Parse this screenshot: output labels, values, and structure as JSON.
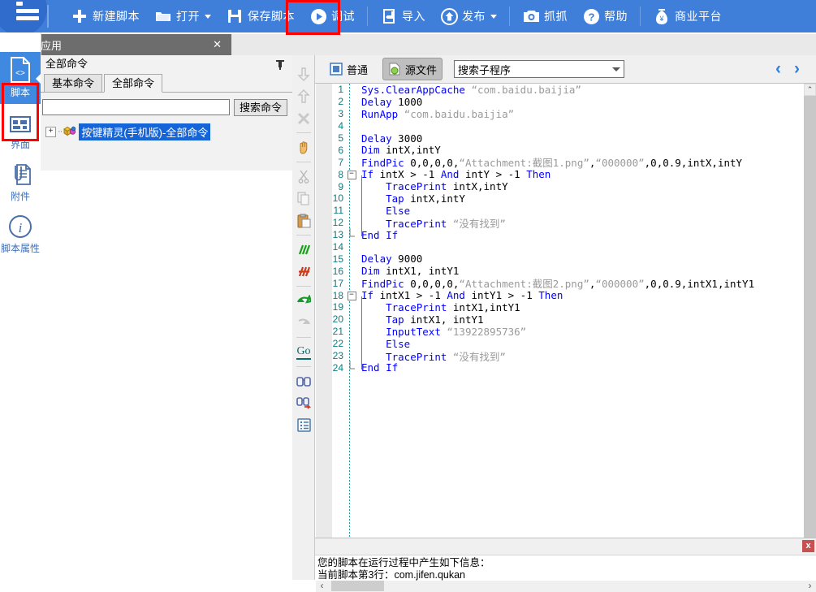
{
  "topbar": {
    "logo_icon": "menu-logo-icon",
    "items": [
      {
        "id": "new-script",
        "label": "新建脚本",
        "icon": "plus-icon",
        "caret": false
      },
      {
        "id": "open",
        "label": "打开",
        "icon": "folder-icon",
        "caret": true
      },
      {
        "id": "save-script",
        "label": "保存脚本",
        "icon": "save-disk-icon",
        "caret": false
      },
      {
        "id": "debug",
        "label": "调试",
        "icon": "play-circle-icon",
        "caret": false,
        "highlighted": true
      },
      {
        "id": "import",
        "label": "导入",
        "icon": "import-arrow-icon",
        "caret": false
      },
      {
        "id": "publish",
        "label": "发布",
        "icon": "upload-circle-icon",
        "caret": true
      },
      {
        "id": "capture",
        "label": "抓抓",
        "icon": "camera-icon",
        "caret": false
      },
      {
        "id": "help",
        "label": "帮助",
        "icon": "question-circle-icon",
        "caret": false
      },
      {
        "id": "business",
        "label": "商业平台",
        "icon": "money-bag-icon",
        "caret": false
      }
    ],
    "highlight_color": "#ff0000",
    "background": "#3f7fd9"
  },
  "window_tab": {
    "title": "打开应用",
    "icon": "app-window-icon",
    "close_label": "✕"
  },
  "leftnav": {
    "items": [
      {
        "id": "script",
        "label": "脚本",
        "icon": "code-file-icon",
        "active": true
      },
      {
        "id": "interface",
        "label": "界面",
        "icon": "grid-layout-icon",
        "active": false
      },
      {
        "id": "attachment",
        "label": "附件",
        "icon": "paperclip-file-icon",
        "active": false
      },
      {
        "id": "script-properties",
        "label": "脚本属性",
        "icon": "info-circle-icon",
        "active": false
      }
    ],
    "active_color": "#3f8ae0",
    "selection_box_color": "#ff0000"
  },
  "command_panel": {
    "title": "全部命令",
    "pin_icon": "pin-icon",
    "tabs": [
      {
        "id": "basic",
        "label": "基本命令",
        "active": false
      },
      {
        "id": "all",
        "label": "全部命令",
        "active": true
      }
    ],
    "search": {
      "value": "",
      "placeholder": ""
    },
    "search_button": "搜索命令",
    "tree": [
      {
        "label": "按键精灵(手机版)-全部命令",
        "expander": "+",
        "icon": "package-icon",
        "selected": true
      }
    ]
  },
  "editor": {
    "modes": [
      {
        "id": "normal",
        "label": "普通",
        "icon": "normal-view-icon",
        "active": false
      },
      {
        "id": "source",
        "label": "源文件",
        "icon": "source-file-icon",
        "active": true
      }
    ],
    "sub_search": {
      "value": "搜索子程序",
      "placeholder": "搜索子程序"
    },
    "nav_prev": "‹",
    "nav_next": "›",
    "rail": [
      {
        "id": "move-down",
        "icon": "arrow-down-icon",
        "enabled": false
      },
      {
        "id": "move-up",
        "icon": "arrow-up-icon",
        "enabled": false
      },
      {
        "id": "delete",
        "icon": "x-delete-icon",
        "enabled": false
      },
      {
        "id": "sep1",
        "icon": "divider",
        "enabled": false
      },
      {
        "id": "hand",
        "icon": "hand-icon",
        "enabled": true
      },
      {
        "id": "sep2",
        "icon": "divider",
        "enabled": false
      },
      {
        "id": "cut",
        "icon": "scissors-icon",
        "enabled": false
      },
      {
        "id": "copy",
        "icon": "copy-icon",
        "enabled": false
      },
      {
        "id": "paste",
        "icon": "paste-clipboard-icon",
        "enabled": true
      },
      {
        "id": "sep3",
        "icon": "divider",
        "enabled": false
      },
      {
        "id": "comment",
        "icon": "comment-lines-icon",
        "enabled": true
      },
      {
        "id": "uncomment",
        "icon": "uncomment-icon",
        "enabled": true
      },
      {
        "id": "sep4",
        "icon": "divider",
        "enabled": false
      },
      {
        "id": "undo",
        "icon": "undo-arrow-icon",
        "enabled": true
      },
      {
        "id": "redo",
        "icon": "redo-arrow-icon",
        "enabled": false
      },
      {
        "id": "sep5",
        "icon": "divider",
        "enabled": false
      },
      {
        "id": "goto",
        "icon": "go-icon",
        "enabled": true
      },
      {
        "id": "sep6",
        "icon": "divider",
        "enabled": false
      },
      {
        "id": "find",
        "icon": "binoculars-icon",
        "enabled": true
      },
      {
        "id": "find-replace",
        "icon": "binoculars-replace-icon",
        "enabled": true
      },
      {
        "id": "properties",
        "icon": "list-properties-icon",
        "enabled": true
      }
    ],
    "code_lines": [
      {
        "n": 1,
        "fold": "",
        "indent": 0,
        "tokens": [
          {
            "t": "Sys.ClearAppCache",
            "c": "fn"
          },
          {
            "t": " ",
            "c": "plain"
          },
          {
            "t": "“com.baidu.baijia”",
            "c": "str"
          }
        ]
      },
      {
        "n": 2,
        "fold": "",
        "indent": 0,
        "tokens": [
          {
            "t": "Delay",
            "c": "kw"
          },
          {
            "t": " 1000",
            "c": "plain"
          }
        ]
      },
      {
        "n": 3,
        "fold": "",
        "indent": 0,
        "tokens": [
          {
            "t": "RunApp",
            "c": "kw"
          },
          {
            "t": " ",
            "c": "plain"
          },
          {
            "t": "“com.baidu.baijia”",
            "c": "str"
          }
        ]
      },
      {
        "n": 4,
        "fold": "",
        "indent": 0,
        "tokens": []
      },
      {
        "n": 5,
        "fold": "",
        "indent": 0,
        "tokens": [
          {
            "t": "Delay",
            "c": "kw"
          },
          {
            "t": " 3000",
            "c": "plain"
          }
        ]
      },
      {
        "n": 6,
        "fold": "",
        "indent": 0,
        "tokens": [
          {
            "t": "Dim",
            "c": "kw"
          },
          {
            "t": " intX,intY",
            "c": "plain"
          }
        ]
      },
      {
        "n": 7,
        "fold": "",
        "indent": 0,
        "tokens": [
          {
            "t": "FindPic",
            "c": "kw"
          },
          {
            "t": " 0,0,0,0,",
            "c": "plain"
          },
          {
            "t": "“Attachment:截图1.png”",
            "c": "str"
          },
          {
            "t": ",",
            "c": "plain"
          },
          {
            "t": "“000000”",
            "c": "str"
          },
          {
            "t": ",0,0.9,intX,intY",
            "c": "plain"
          }
        ]
      },
      {
        "n": 8,
        "fold": "-",
        "indent": 0,
        "tokens": [
          {
            "t": "If",
            "c": "kw"
          },
          {
            "t": " intX > -1 ",
            "c": "plain"
          },
          {
            "t": "And",
            "c": "kw"
          },
          {
            "t": " intY > -1 ",
            "c": "plain"
          },
          {
            "t": "Then",
            "c": "kw"
          }
        ]
      },
      {
        "n": 9,
        "fold": "",
        "indent": 2,
        "tokens": [
          {
            "t": "TracePrint",
            "c": "kw"
          },
          {
            "t": " intX,intY",
            "c": "plain"
          }
        ]
      },
      {
        "n": 10,
        "fold": "",
        "indent": 2,
        "tokens": [
          {
            "t": "Tap",
            "c": "kw"
          },
          {
            "t": " intX,intY",
            "c": "plain"
          }
        ]
      },
      {
        "n": 11,
        "fold": "",
        "indent": 2,
        "tokens": [
          {
            "t": "Else",
            "c": "kw"
          }
        ]
      },
      {
        "n": 12,
        "fold": "",
        "indent": 2,
        "tokens": [
          {
            "t": "TracePrint",
            "c": "kw"
          },
          {
            "t": " ",
            "c": "plain"
          },
          {
            "t": "“没有找到”",
            "c": "str"
          }
        ]
      },
      {
        "n": 13,
        "fold": "L",
        "indent": 0,
        "tokens": [
          {
            "t": "End If",
            "c": "kw"
          }
        ]
      },
      {
        "n": 14,
        "fold": "",
        "indent": 0,
        "tokens": []
      },
      {
        "n": 15,
        "fold": "",
        "indent": 0,
        "tokens": [
          {
            "t": "Delay",
            "c": "kw"
          },
          {
            "t": " 9000",
            "c": "plain"
          }
        ]
      },
      {
        "n": 16,
        "fold": "",
        "indent": 0,
        "tokens": [
          {
            "t": "Dim",
            "c": "kw"
          },
          {
            "t": " intX1, intY1",
            "c": "plain"
          }
        ]
      },
      {
        "n": 17,
        "fold": "",
        "indent": 0,
        "tokens": [
          {
            "t": "FindPic",
            "c": "kw"
          },
          {
            "t": " 0,0,0,0,",
            "c": "plain"
          },
          {
            "t": "“Attachment:截图2.png”",
            "c": "str"
          },
          {
            "t": ",",
            "c": "plain"
          },
          {
            "t": "“000000”",
            "c": "str"
          },
          {
            "t": ",0,0.9,intX1,intY1",
            "c": "plain"
          }
        ]
      },
      {
        "n": 18,
        "fold": "-",
        "indent": 0,
        "tokens": [
          {
            "t": "If",
            "c": "kw"
          },
          {
            "t": " intX1 > -1 ",
            "c": "plain"
          },
          {
            "t": "And",
            "c": "kw"
          },
          {
            "t": " intY1 > -1 ",
            "c": "plain"
          },
          {
            "t": "Then",
            "c": "kw"
          }
        ]
      },
      {
        "n": 19,
        "fold": "",
        "indent": 2,
        "tokens": [
          {
            "t": "TracePrint",
            "c": "kw"
          },
          {
            "t": " intX1,intY1",
            "c": "plain"
          }
        ]
      },
      {
        "n": 20,
        "fold": "",
        "indent": 2,
        "tokens": [
          {
            "t": "Tap",
            "c": "kw"
          },
          {
            "t": " intX1, intY1",
            "c": "plain"
          }
        ]
      },
      {
        "n": 21,
        "fold": "",
        "indent": 2,
        "tokens": [
          {
            "t": "InputText",
            "c": "kw"
          },
          {
            "t": " ",
            "c": "plain"
          },
          {
            "t": "“13922895736”",
            "c": "str"
          }
        ]
      },
      {
        "n": 22,
        "fold": "",
        "indent": 2,
        "tokens": [
          {
            "t": "Else",
            "c": "kw"
          }
        ]
      },
      {
        "n": 23,
        "fold": "",
        "indent": 2,
        "tokens": [
          {
            "t": "TracePrint",
            "c": "kw"
          },
          {
            "t": " ",
            "c": "plain"
          },
          {
            "t": "“没有找到”",
            "c": "str"
          }
        ]
      },
      {
        "n": 24,
        "fold": "L",
        "indent": 0,
        "tokens": [
          {
            "t": "End If",
            "c": "kw"
          }
        ]
      }
    ]
  },
  "output": {
    "close_label": "x",
    "lines": [
      "您的脚本在运行过程中产生如下信息：",
      "当前脚本第3行：com.jifen.qukan"
    ]
  },
  "scrollbars": {
    "h_left": "‹",
    "h_right": "›",
    "v_up": "⌃"
  }
}
